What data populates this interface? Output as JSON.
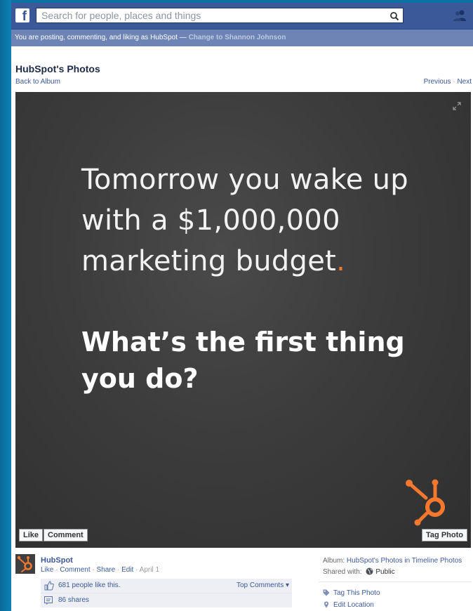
{
  "header": {
    "logo_letter": "f",
    "search": {
      "placeholder": "Search for people, places and things"
    }
  },
  "notice": {
    "text": "You are posting, commenting, and liking as HubSpot — ",
    "link": "Change to Shannon Johnson"
  },
  "album": {
    "title": "HubSpot's Photos",
    "back_link": "Back to Album",
    "previous": "Previous",
    "separator": "·",
    "next": "Next"
  },
  "photo": {
    "line1": "Tomorrow you wake up with a $1,000,000 marketing budget",
    "line1_dot": ".",
    "line2": "What’s the first thing you do?",
    "like_button": "Like",
    "comment_button": "Comment",
    "tag_button": "Tag Photo"
  },
  "post": {
    "poster": "HubSpot",
    "actions": {
      "like": "Like",
      "comment": "Comment",
      "share": "Share",
      "edit": "Edit",
      "date": "April 1",
      "sep": " · "
    },
    "likes_text": "681 people like this.",
    "shares_text": "86 shares",
    "top_comments": "Top Comments ▾"
  },
  "sidebar": {
    "album_label": "Album: ",
    "album_value": "HubSpot's Photos in Timeline Photos",
    "shared_label": "Shared with: ",
    "shared_value": "Public",
    "tag_this_photo": "Tag This Photo",
    "edit_location": "Edit Location"
  },
  "colors": {
    "facebook_blue": "#3b5998",
    "notice_bar": "#6d84b4",
    "hubspot_orange": "#f5782d",
    "frame": "#0d74a6"
  }
}
